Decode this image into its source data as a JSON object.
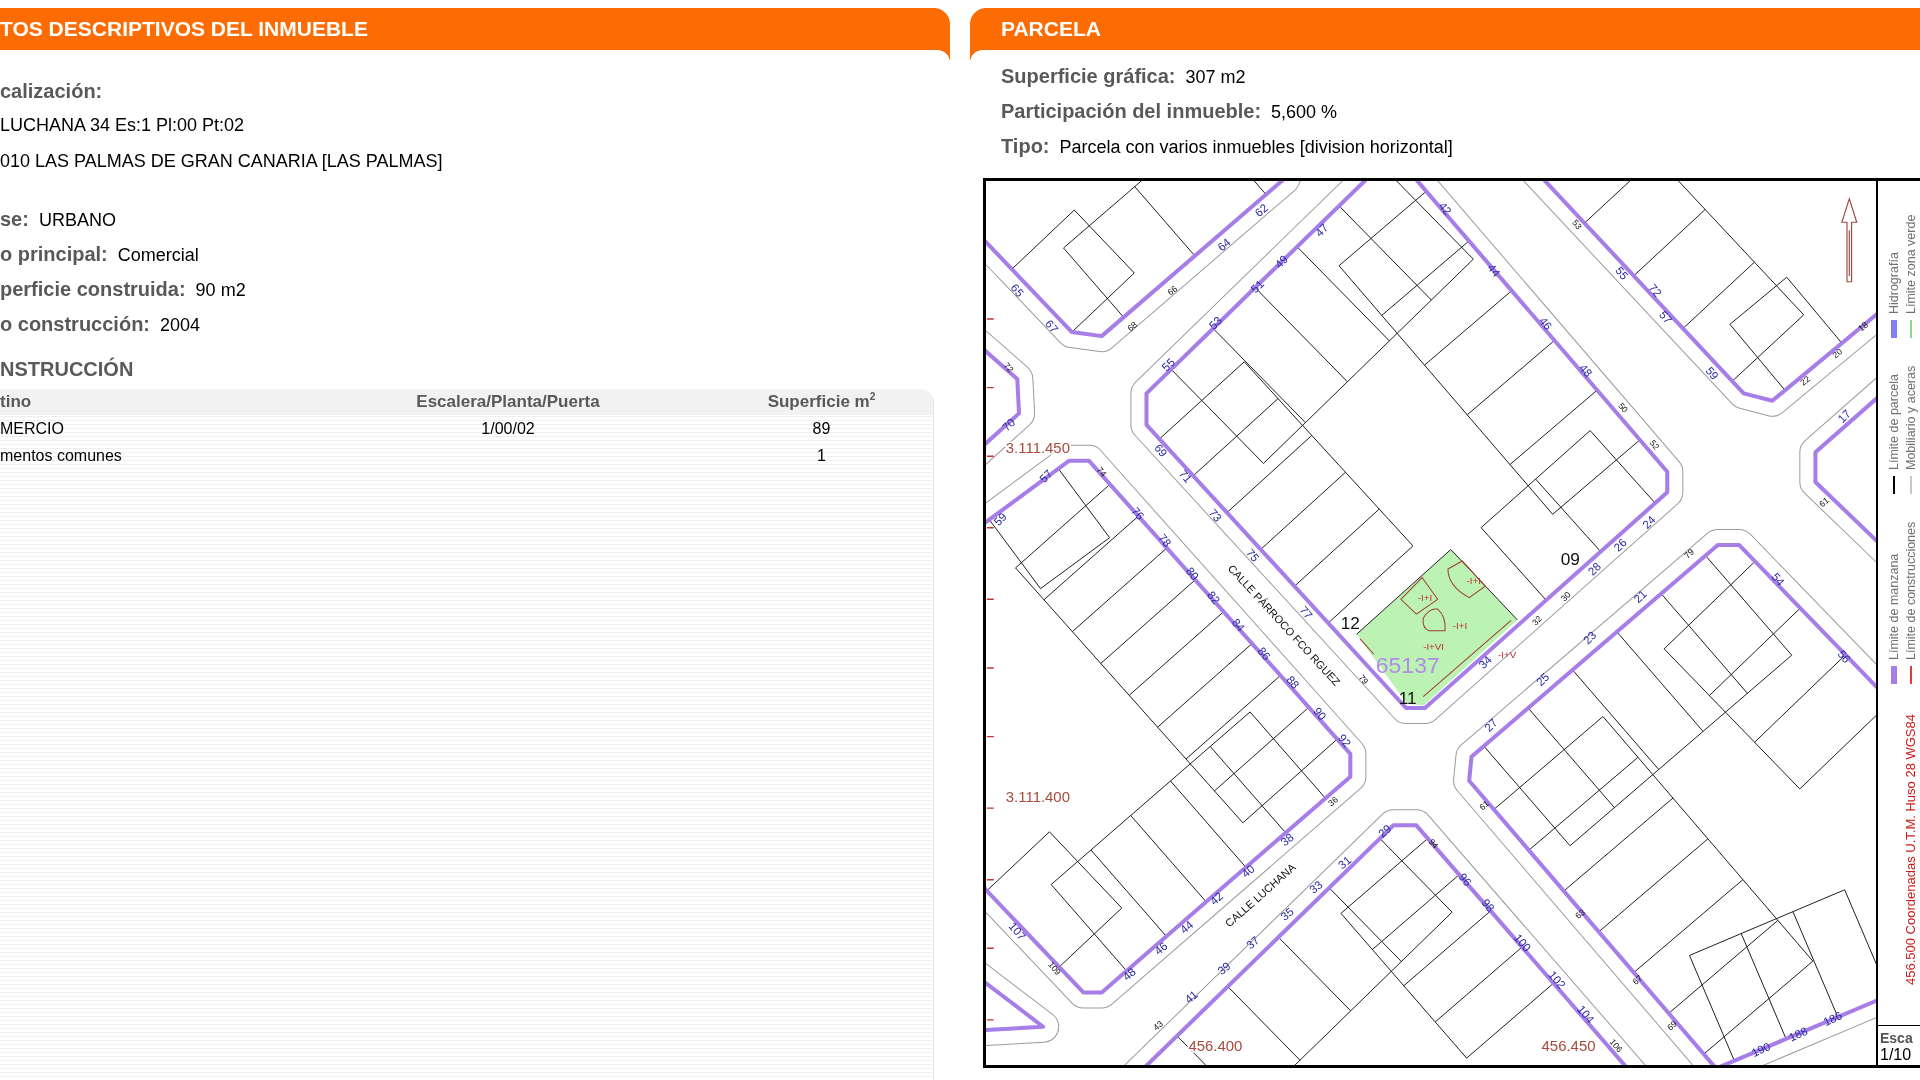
{
  "property_panel": {
    "title": "TOS DESCRIPTIVOS DEL INMUEBLE",
    "location_label": "calización:",
    "address_lines": [
      "LUCHANA 34 Es:1 Pl:00 Pt:02",
      "010 LAS PALMAS DE GRAN CANARIA [LAS PALMAS]"
    ],
    "fields": [
      {
        "label": "se:",
        "value": "URBANO"
      },
      {
        "label": "o principal:",
        "value": "Comercial"
      },
      {
        "label": "perficie construida:",
        "value": "90 m2"
      },
      {
        "label": "o construcción:",
        "value": "2004"
      }
    ],
    "construction": {
      "title": "NSTRUCCIÓN",
      "columns": [
        "tino",
        "Escalera/Planta/Puerta",
        "Superficie m$^{2}$"
      ],
      "rows": [
        {
          "column_1": "MERCIO",
          "escalera_planta_puerta": "1/00/02",
          "superficie": "89"
        },
        {
          "column_1": "mentos comunes",
          "superficie": "1"
        }
      ]
    }
  },
  "parcel_panel": {
    "title": "PARCELA",
    "fields": [
      {
        "label": "Superficie gráfica:",
        "value": "307 m2"
      },
      {
        "label": "Participación del inmueble:",
        "value": "5,600 %"
      },
      {
        "label": "Tipo:",
        "value": "Parcela con varios inmuebles [division horizontal]"
      }
    ],
    "map": {
      "highlighted_parcel": {
        "highlighted": true,
        "floor_labels": [
          "-I+I",
          "-I+I",
          "-I+I",
          "-I+VI",
          "-I+V"
        ]
      },
      "block_number": "65137",
      "plot_numbers": [
        "12",
        "11",
        "09"
      ],
      "street_names": [
        "CALLE PÁRROCO FCO RGUEZ",
        "CALLE LUCHANA"
      ],
      "northing_labels": [
        "3.111.450",
        "3.111.400"
      ],
      "easting_labels": [
        "456.400",
        "456.450"
      ],
      "street_numbers": [
        "65",
        "67",
        "64",
        "62",
        "55",
        "53",
        "51",
        "49",
        "47",
        "42",
        "44",
        "46",
        "48",
        "24",
        "26",
        "28",
        "34",
        "69",
        "71",
        "73",
        "75",
        "77",
        "55",
        "72",
        "57",
        "59",
        "17",
        "70",
        "59",
        "57",
        "76",
        "78",
        "80",
        "82",
        "84",
        "86",
        "88",
        "90",
        "92",
        "38",
        "40",
        "42",
        "44",
        "46",
        "48",
        "107",
        "41",
        "39",
        "37",
        "35",
        "33",
        "31",
        "29",
        "96",
        "98",
        "100",
        "102",
        "104",
        "27",
        "25",
        "23",
        "21",
        "54",
        "56",
        "190",
        "188",
        "186"
      ],
      "minor_numbers": [
        "68",
        "66",
        "50",
        "52",
        "30",
        "32",
        "79",
        "53",
        "22",
        "20",
        "18",
        "61",
        "72",
        "74",
        "36",
        "109",
        "43",
        "94",
        "106",
        "79",
        "61",
        "63",
        "67",
        "69"
      ],
      "legend": [
        {
          "label": "Límite de manzana",
          "color": "#a77de8",
          "kind": "band"
        },
        {
          "label": "Límite de parcela",
          "color": "#000000",
          "kind": "line"
        },
        {
          "label": "Hidrografía",
          "color": "#8080f0",
          "kind": "band"
        },
        {
          "label": "Límite de construcciones",
          "color": "#e03a3a",
          "kind": "line"
        },
        {
          "label": "Mobiliario y aceras",
          "color": "#c8c8c8",
          "kind": "line"
        },
        {
          "label": "Límite zona verde",
          "color": "#8fd68f",
          "kind": "line"
        }
      ],
      "coordinate_note": "456.500 Coordenadas U.T.M. Huso 28 WGS84",
      "scale_label": "Esca",
      "scale_value": "1/10"
    }
  }
}
